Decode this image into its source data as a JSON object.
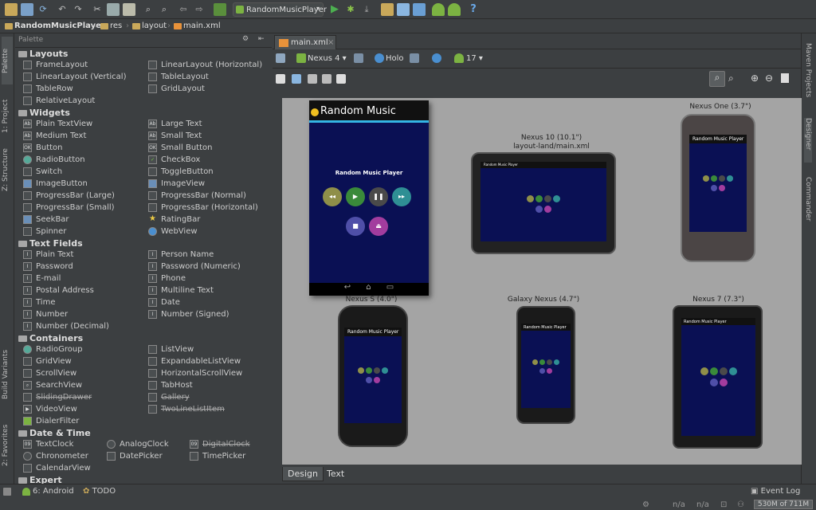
{
  "toolbar": {
    "run_config": "RandomMusicPlayer",
    "icons": [
      "open-icon",
      "save-icon",
      "sync-icon",
      "undo-icon",
      "redo-icon",
      "cut-icon",
      "copy-icon",
      "paste-icon",
      "find-icon",
      "replace-icon",
      "back-icon",
      "forward-icon",
      "module-icon",
      "run-icon",
      "debug-icon",
      "attach-icon",
      "stop-icon",
      "sdk-manager-icon",
      "avd-manager-icon",
      "sync-gradle-icon",
      "android-icon",
      "help-icon"
    ]
  },
  "breadcrumb": [
    "RandomMusicPlayer",
    "res",
    "layout",
    "main.xml"
  ],
  "left_strip": {
    "palette": "Palette",
    "project": "1: Project",
    "structure": "Z: Structure",
    "build_variants": "Build Variants",
    "favorites": "2: Favorites"
  },
  "right_strip": {
    "maven": "Maven Projects",
    "designer": "Designer",
    "commander": "Commander"
  },
  "palette": {
    "title": "Palette",
    "categories": [
      {
        "name": "Layouts",
        "items": [
          "FrameLayout",
          "LinearLayout (Horizontal)",
          "LinearLayout (Vertical)",
          "TableLayout",
          "TableRow",
          "GridLayout",
          "RelativeLayout"
        ]
      },
      {
        "name": "Widgets",
        "items": [
          "Plain TextView",
          "Large Text",
          "Medium Text",
          "Small Text",
          "Button",
          "Small Button",
          "RadioButton",
          "CheckBox",
          "Switch",
          "ToggleButton",
          "ImageButton",
          "ImageView",
          "ProgressBar (Large)",
          "ProgressBar (Normal)",
          "ProgressBar (Small)",
          "ProgressBar (Horizontal)",
          "SeekBar",
          "RatingBar",
          "Spinner",
          "WebView"
        ]
      },
      {
        "name": "Text Fields",
        "items": [
          "Plain Text",
          "Person Name",
          "Password",
          "Password (Numeric)",
          "E-mail",
          "Phone",
          "Postal Address",
          "Multiline Text",
          "Time",
          "Date",
          "Number",
          "Number (Signed)",
          "Number (Decimal)"
        ]
      },
      {
        "name": "Containers",
        "items": [
          "RadioGroup",
          "ListView",
          "GridView",
          "ExpandableListView",
          "ScrollView",
          "HorizontalScrollView",
          "SearchView",
          "TabHost",
          "SlidingDrawer",
          "Gallery",
          "VideoView",
          "TwoLineListItem",
          "DialerFilter"
        ]
      },
      {
        "name": "Date & Time",
        "items": [
          "TextClock",
          "AnalogClock",
          "DigitalClock",
          "Chronometer",
          "DatePicker",
          "TimePicker",
          "CalendarView"
        ]
      },
      {
        "name": "Expert",
        "items": []
      }
    ]
  },
  "editor": {
    "tab": "main.xml",
    "device": "Nexus 4",
    "theme": "Holo",
    "api": "17",
    "main_preview": {
      "app_title": "Random Music",
      "heading": "Random Music Player"
    },
    "previews": [
      {
        "label": "Nexus 10 (10.1\")",
        "sub": "layout-land/main.xml"
      },
      {
        "label": "Nexus One (3.7\")"
      },
      {
        "label": "Nexus S (4.0\")"
      },
      {
        "label": "Galaxy Nexus (4.7\")"
      },
      {
        "label": "Nexus 7 (7.3\")"
      }
    ],
    "small_title": "Random Music Player",
    "bottom_tabs": [
      "Design",
      "Text"
    ]
  },
  "status": {
    "android": "6: Android",
    "todo": "TODO",
    "event_log": "Event Log",
    "na1": "n/a",
    "na2": "n/a",
    "memory": "530M of 711M"
  },
  "colors": {
    "bg": "#3c3f41",
    "canvas": "#a4a4a4",
    "screen": "#0a1054",
    "btn_olive": "#8f8f49",
    "btn_green": "#3a8a3a",
    "btn_gray": "#4a4a4a",
    "btn_teal": "#2f8f94",
    "btn_indigo": "#4f4fa8",
    "btn_magenta": "#a23c9e"
  }
}
